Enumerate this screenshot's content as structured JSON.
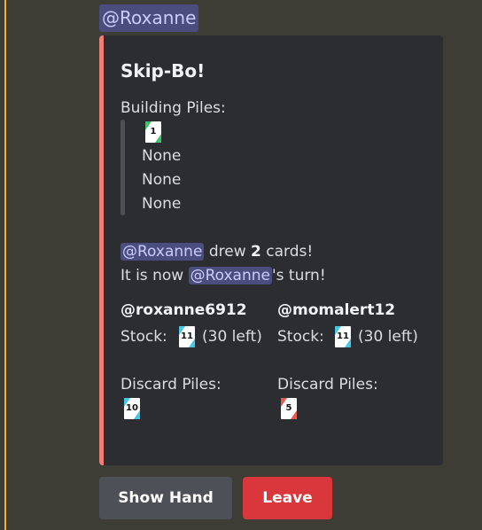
{
  "message": {
    "mention": "@Roxanne"
  },
  "embed": {
    "title": "Skip-Bo!",
    "building_label": "Building Piles:",
    "building_card": "1",
    "building_piles": [
      "None",
      "None",
      "None"
    ],
    "event_mention": "@Roxanne",
    "event_text": "drew",
    "event_count": "2",
    "event_suffix": "cards!",
    "turn_prefix": "It is now",
    "turn_mention": "@Roxanne",
    "turn_suffix": "'s turn!",
    "players": [
      {
        "name": "@roxanne6912",
        "stock_label": "Stock:",
        "stock_card": "11",
        "stock_left": "(30 left)",
        "discard_label": "Discard Piles:",
        "discard_card": "10"
      },
      {
        "name": "@momalert12",
        "stock_label": "Stock:",
        "stock_card": "11",
        "stock_left": "(30 left)",
        "discard_label": "Discard Piles:",
        "discard_card": "5"
      }
    ]
  },
  "buttons": {
    "show_hand": "Show Hand",
    "leave": "Leave"
  },
  "colors": {
    "embed_stripe": "#ef7f76",
    "mention_bg": "#4a4d7e",
    "leave_button": "#da373c",
    "show_hand_button": "#4e5058",
    "card_green": "#40c070",
    "card_blue": "#44c7e8",
    "card_red": "#e85a4e"
  }
}
